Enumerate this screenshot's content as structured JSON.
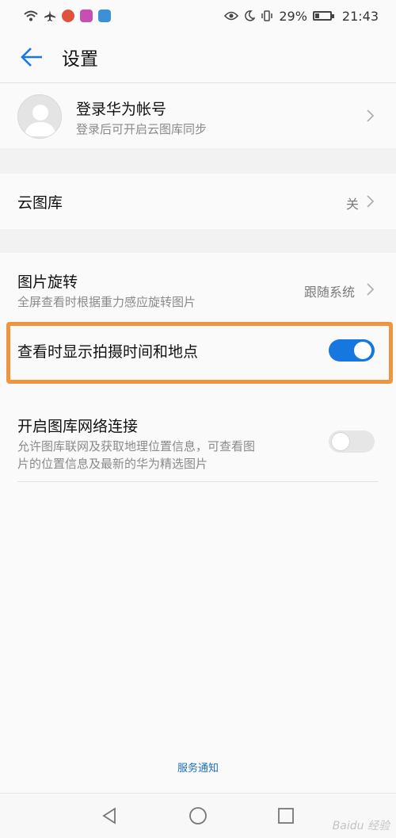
{
  "status_bar": {
    "battery_percent": "29%",
    "time": "21:43",
    "battery_level": 0.29,
    "left_icons": [
      "wifi-icon",
      "airplane-icon",
      "app-notification-icon",
      "app-notification-icon",
      "app-notification-icon"
    ],
    "right_icons": [
      "eye-comfort-icon",
      "do-not-disturb-icon",
      "vibrate-icon",
      "battery-icon"
    ]
  },
  "header": {
    "title": "设置",
    "back_icon": "arrow-left-icon",
    "accent": "#1677e0"
  },
  "account": {
    "title": "登录华为帐号",
    "subtitle": "登录后可开启云图库同步",
    "avatar_icon": "default-avatar-icon"
  },
  "cloud_gallery": {
    "title": "云图库",
    "value": "关"
  },
  "rotation": {
    "title": "图片旋转",
    "subtitle": "全屏查看时根据重力感应旋转图片",
    "value": "跟随系统"
  },
  "show_time_location": {
    "title": "查看时显示拍摄时间和地点",
    "enabled": true,
    "highlight_color": "#f0953f"
  },
  "network": {
    "title": "开启图库网络连接",
    "subtitle_line1": "允许图库联网及获取地理位置信息，可查看图",
    "subtitle_line2": "片的位置信息及最新的华为精选图片",
    "enabled": false
  },
  "footer": {
    "link": "服务通知"
  },
  "nav": {
    "icons": [
      "back-triangle-icon",
      "home-circle-icon",
      "recents-square-icon"
    ]
  },
  "watermark": "Baidu 经验"
}
